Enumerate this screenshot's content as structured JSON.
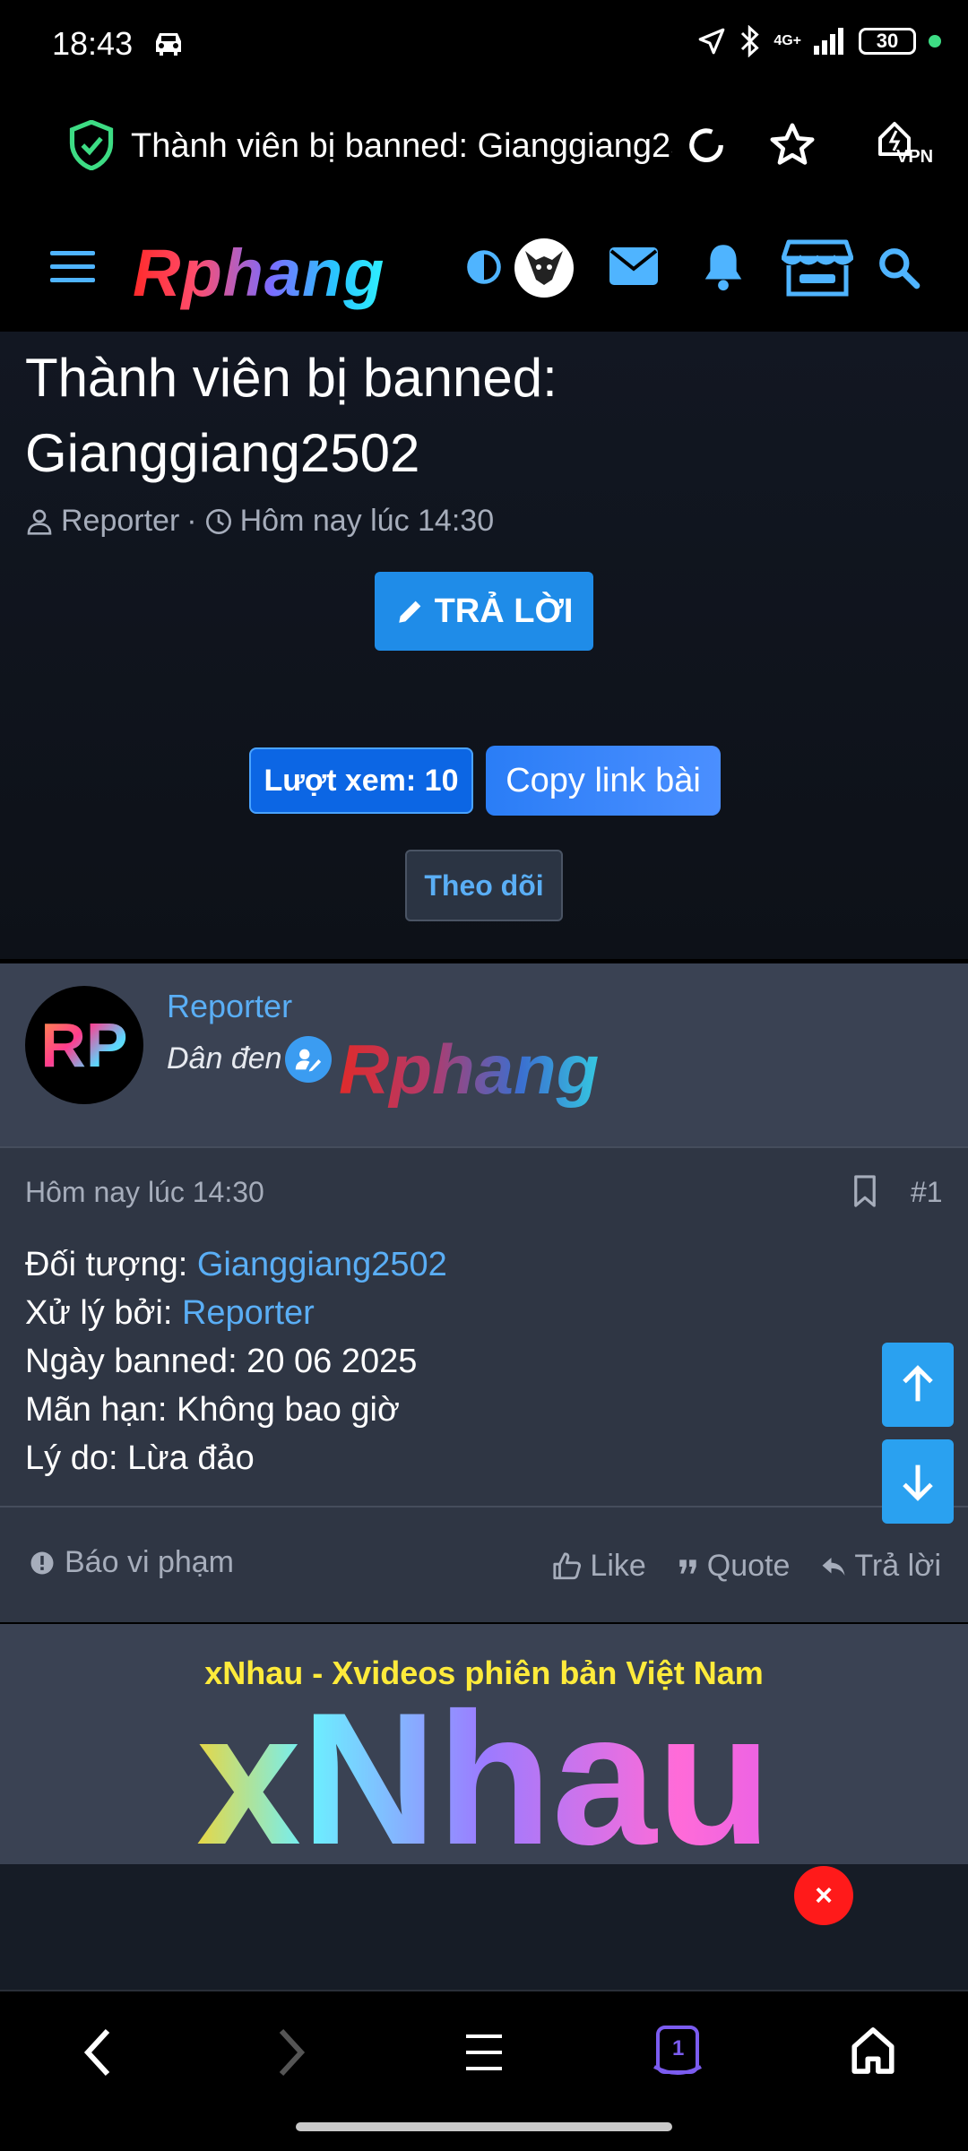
{
  "status_bar": {
    "time": "18:43",
    "network": "4G+",
    "battery": "30"
  },
  "browser": {
    "url_title": "Thành viên bị banned: Gianggiang2502",
    "vpn_label": "VPN"
  },
  "forum": {
    "logo_text": "Rphang"
  },
  "thread": {
    "title": "Thành viên bị banned: Gianggiang2502",
    "author": "Reporter",
    "time": "Hôm nay lúc 14:30",
    "reply_label": "TRẢ LỜI",
    "views_label": "Lượt xem: 10",
    "copy_label": "Copy link bài",
    "follow_label": "Theo dõi"
  },
  "post": {
    "user": {
      "avatar_text": "RP",
      "name": "Reporter",
      "title": "Dân đen",
      "banner_text": "Rphang"
    },
    "date": "Hôm nay lúc 14:30",
    "number": "#1",
    "lines": {
      "target_label": "Đối tượng: ",
      "target_value": "Gianggiang2502",
      "handled_label": "Xử lý bởi: ",
      "handled_value": "Reporter",
      "date_text": "Ngày banned: 20 06 2025",
      "expiry_text": "Mãn hạn: Không bao giờ",
      "reason_text": "Lý do: Lừa đảo"
    },
    "actions": {
      "report": "Báo vi phạm",
      "like": "Like",
      "quote": "Quote",
      "reply": "Trả lời"
    }
  },
  "ad": {
    "title": "xNhau - Xvideos phiên bản Việt Nam",
    "logo": "xNhau",
    "close": "×"
  },
  "bottom_nav": {
    "tab_count": "1"
  },
  "colors": {
    "accent": "#1f8ce8",
    "link": "#5aaef5",
    "card_bg": "#3a4253",
    "post_bg": "#2f3644"
  }
}
